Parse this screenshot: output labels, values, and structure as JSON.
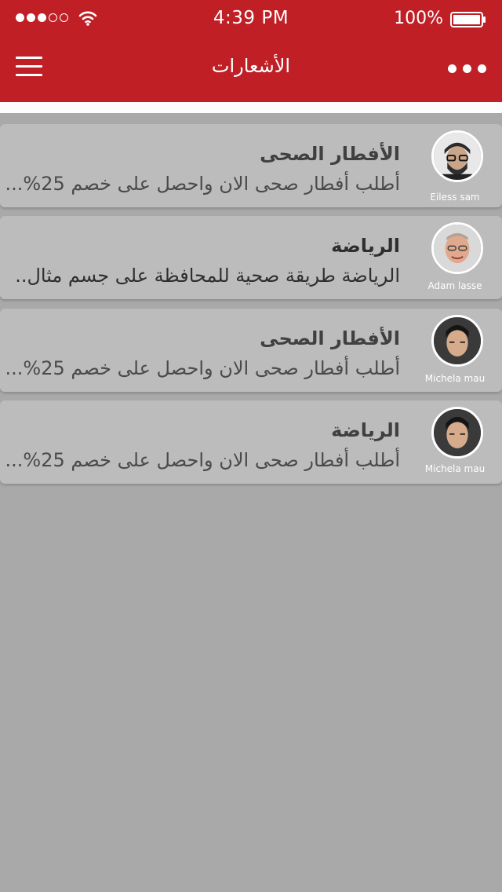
{
  "status_bar": {
    "time": "4:39 PM",
    "battery": "100%",
    "signal_icon": "signal-dots-icon",
    "wifi_icon": "wifi-icon",
    "battery_icon": "battery-icon"
  },
  "nav": {
    "title": "الأشعارات",
    "menu_icon": "hamburger-menu-icon",
    "more_icon": "more-dots-icon"
  },
  "colors": {
    "header": "#bf1f25",
    "background": "#a9a9a9",
    "card": "#bcbcbc"
  },
  "notifications": [
    {
      "title": "الأفطار الصحى",
      "text": "أطلب أفطار صحى الان واحصل على خصم 25%...",
      "author": "Eiless sam"
    },
    {
      "title": "الرياضة",
      "text": "الرياضة طريقة صحية للمحافظة على جسم مثال..",
      "author": "Adam lasse"
    },
    {
      "title": "الأفطار الصحى",
      "text": "أطلب أفطار صحى الان واحصل على خصم 25%...",
      "author": "Michela mau"
    },
    {
      "title": "الرياضة",
      "text": "أطلب أفطار صحى الان واحصل على خصم 25%...",
      "author": "Michela mau"
    }
  ]
}
